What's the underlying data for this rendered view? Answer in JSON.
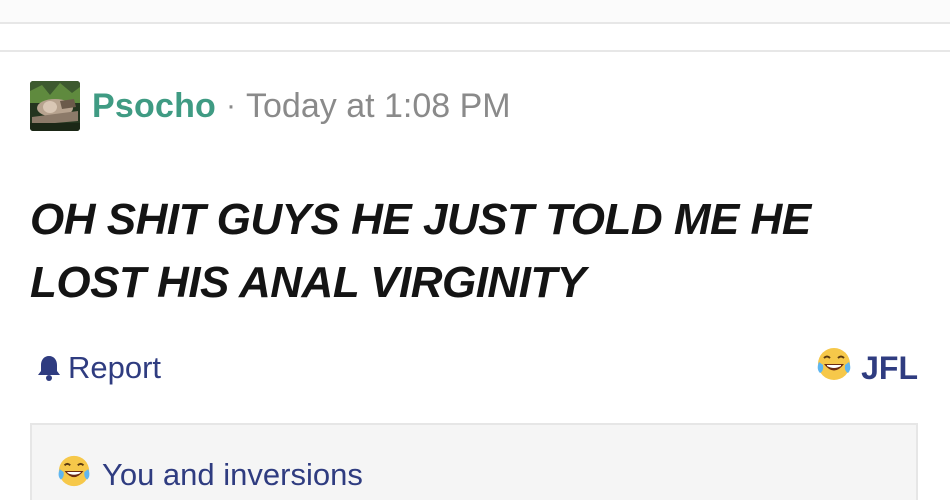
{
  "post": {
    "author": "Psocho",
    "separator": "·",
    "timestamp": "Today at 1:08 PM",
    "message": "OH SHIT GUYS HE JUST TOLD ME HE LOST HIS ANAL VIRGINITY"
  },
  "actions": {
    "report_label": "Report",
    "react_label": "JFL",
    "report_icon": "bell-icon",
    "react_icon": "laughing-crying-emoji-icon"
  },
  "reactions": {
    "summary": "You and inversions",
    "icon": "laughing-crying-emoji-icon"
  },
  "colors": {
    "author": "#3f9b83",
    "link": "#2f3c80",
    "muted": "#8a8a8a"
  }
}
